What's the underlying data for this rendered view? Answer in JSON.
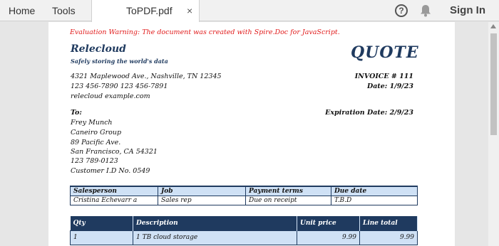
{
  "toolbar": {
    "home": "Home",
    "tools": "Tools",
    "file_tab": "ToPDF.pdf",
    "close": "×",
    "help": "?",
    "sign_in": "Sign In"
  },
  "document": {
    "warning": "Evaluation Warning: The document was created with Spire.Doc for JavaScript.",
    "company": "Relecloud",
    "slogan": "Safely storing the world's data",
    "title": "QUOTE",
    "address": "4321 Maplewood Ave., Nashville, TN 12345",
    "phone1": "123  456-7890   123  456-7891",
    "website": "relecloud  example.com",
    "invoice": "INVOICE # 111",
    "date": "Date: 1/9/23",
    "to_label": "To:",
    "expiration": "Expiration Date: 2/9/23",
    "recipient": [
      "Frey Munch",
      "Caneiro Group",
      "89 Pacific Ave.",
      "San Francisco, CA 54321",
      "123  789-0123",
      "Customer I.D No. 0549"
    ],
    "info_table": {
      "headers": [
        "Salesperson",
        "Job",
        "Payment terms",
        "Due date"
      ],
      "row": [
        "Cristina Echevarr  a",
        "Sales rep",
        "Due on receipt",
        "T.B.D"
      ]
    },
    "items_table": {
      "headers": [
        "Qty",
        "Description",
        "Unit price",
        "Line total"
      ],
      "rows": [
        [
          "1",
          "1 TB cloud storage",
          "9.99",
          "9.99"
        ]
      ]
    }
  },
  "colors": {
    "accent": "#1f3a5f",
    "warning": "#e11b1b",
    "table_fill": "#cfe1f5"
  }
}
